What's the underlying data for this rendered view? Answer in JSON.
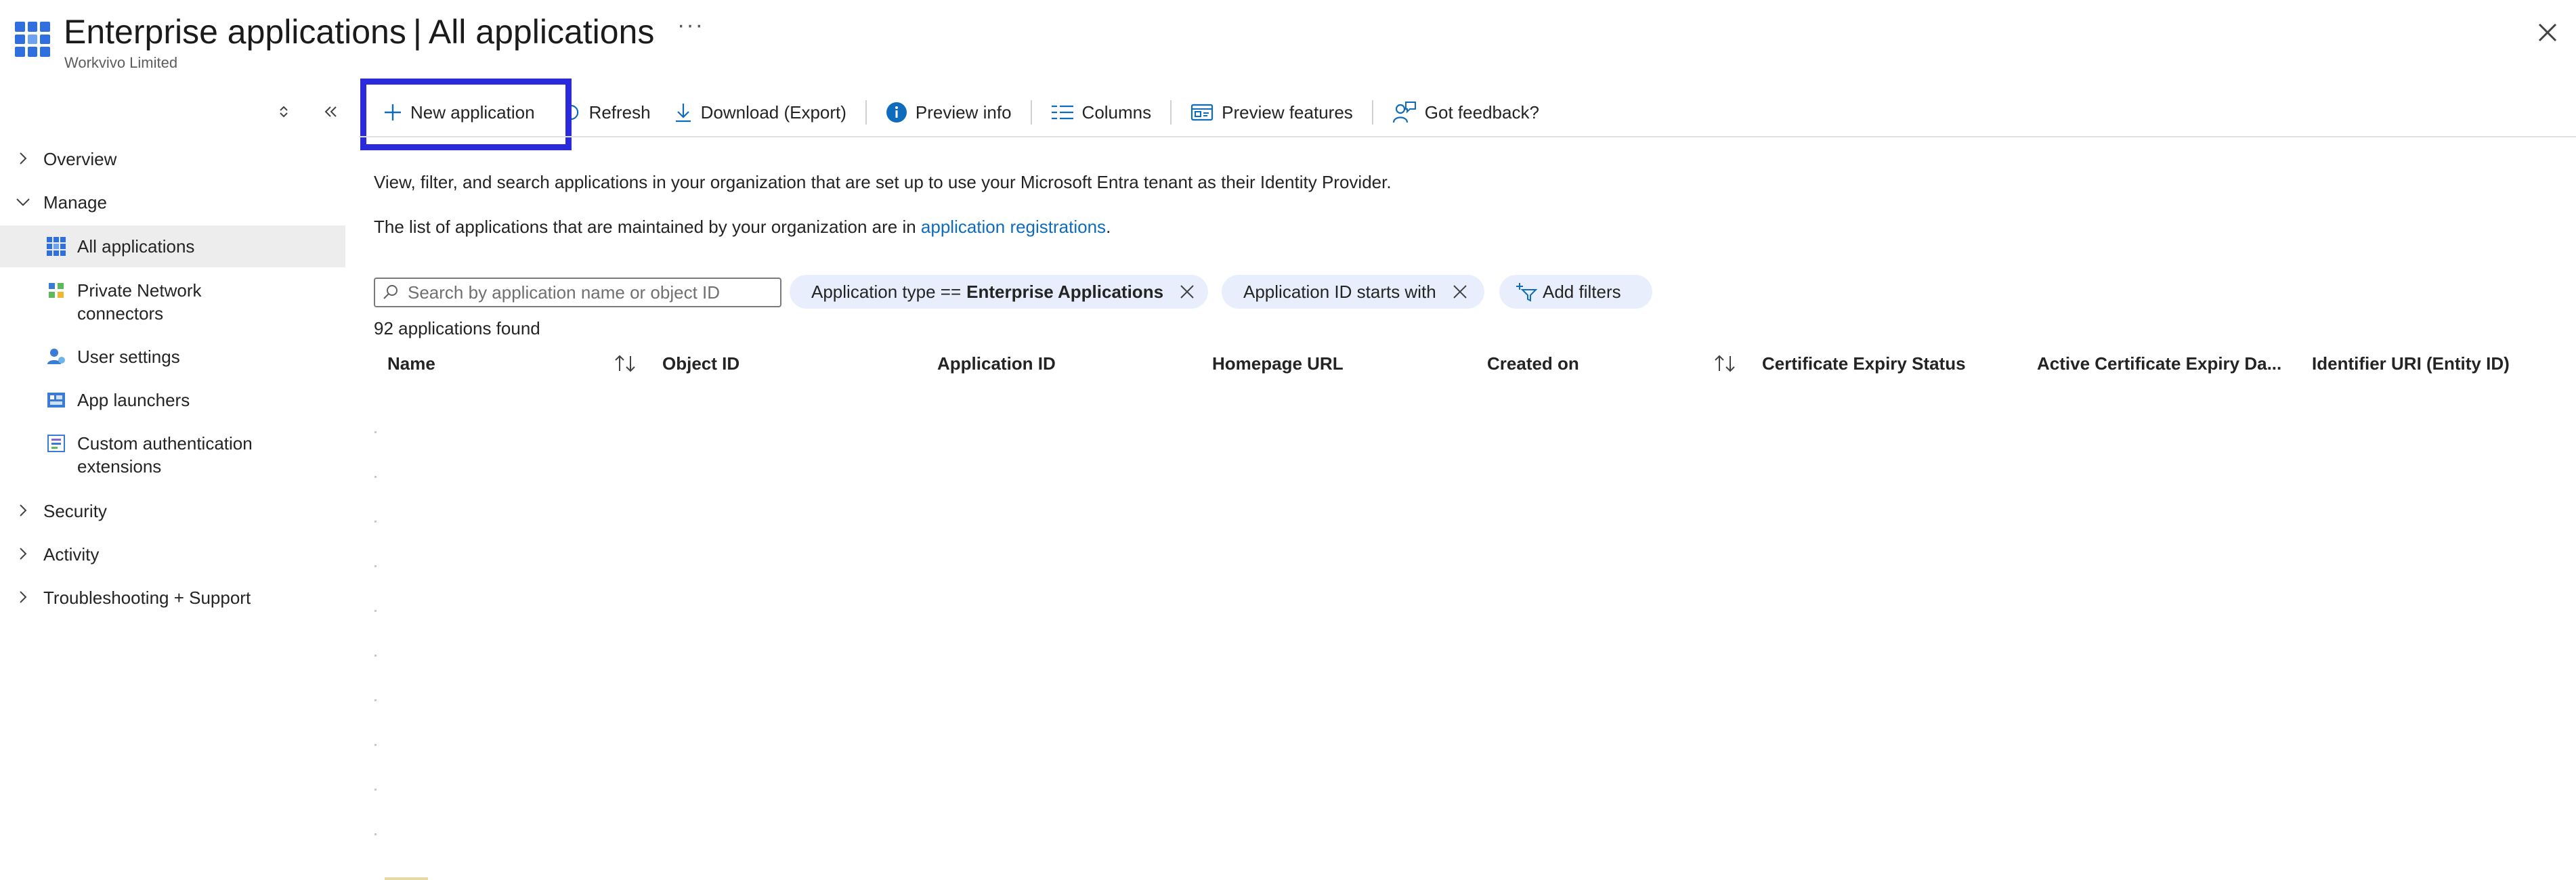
{
  "header": {
    "title_main": "Enterprise applications",
    "title_separator": "|",
    "title_section": "All applications",
    "more_label": "···",
    "subtitle": "Workvivo Limited"
  },
  "sidebar": {
    "items": [
      {
        "label": "Overview"
      },
      {
        "label": "Manage"
      },
      {
        "label_line1": "All applications",
        "icon": "grid-icon"
      },
      {
        "label_line1": "Private Network",
        "label_line2": "connectors",
        "icon": "network-icon"
      },
      {
        "label_line1": "User settings",
        "icon": "user-settings-icon"
      },
      {
        "label_line1": "App launchers",
        "icon": "app-launcher-icon"
      },
      {
        "label_line1": "Custom authentication",
        "label_line2": "extensions",
        "icon": "extension-icon"
      },
      {
        "label": "Security"
      },
      {
        "label": "Activity"
      },
      {
        "label": "Troubleshooting + Support"
      }
    ]
  },
  "toolbar": {
    "new_application": "New application",
    "refresh": "Refresh",
    "download": "Download (Export)",
    "preview_info": "Preview info",
    "columns": "Columns",
    "preview_features": "Preview features",
    "feedback": "Got feedback?"
  },
  "content": {
    "description_1": "View, filter, and search applications in your organization that are set up to use your Microsoft Entra tenant as their Identity Provider.",
    "description_2_prefix": "The list of applications that are maintained by your organization are in ",
    "description_2_link": "application registrations",
    "description_2_suffix": ".",
    "search_placeholder": "Search by application name or object ID",
    "filters": [
      {
        "label": "Application type == ",
        "value": "Enterprise Applications"
      },
      {
        "label": "Application ID starts with",
        "value": ""
      }
    ],
    "add_filters": "Add filters",
    "result_count": "92 applications found",
    "columns": [
      "Name",
      "Object ID",
      "Application ID",
      "Homepage URL",
      "Created on",
      "Certificate Expiry Status",
      "Active Certificate Expiry Da...",
      "Identifier URI (Entity ID)"
    ]
  },
  "colors": {
    "accent": "#0f6cbd",
    "highlight_box": "#2b2bdc",
    "selected_nav": "#ededed",
    "filter_pill": "#e8eefb"
  }
}
